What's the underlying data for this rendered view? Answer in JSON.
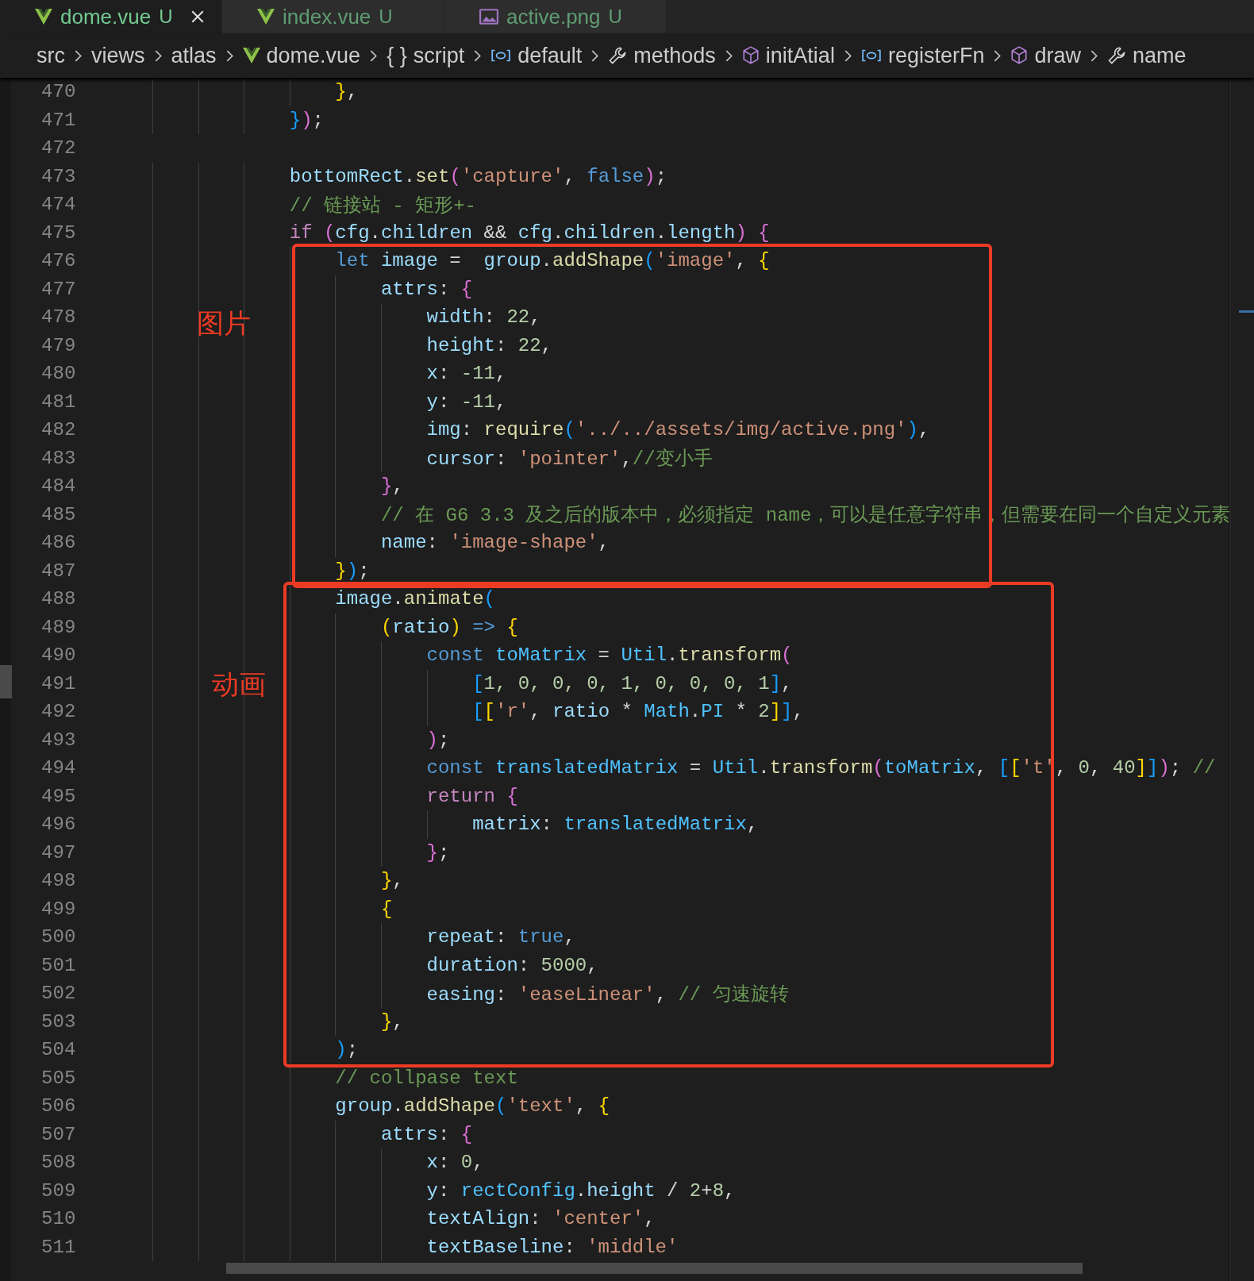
{
  "tabs": [
    {
      "label": "dome.vue",
      "status": "U",
      "kind": "vue",
      "selected": true
    },
    {
      "label": "index.vue",
      "status": "U",
      "kind": "vue",
      "selected": false
    },
    {
      "label": "active.png",
      "status": "U",
      "kind": "image",
      "selected": false
    }
  ],
  "breadcrumb": [
    {
      "label": "src",
      "kind": "folder"
    },
    {
      "label": "views",
      "kind": "folder"
    },
    {
      "label": "atlas",
      "kind": "folder"
    },
    {
      "label": "dome.vue",
      "kind": "vue"
    },
    {
      "label": "script",
      "kind": "glyph",
      "glyph": "{ }"
    },
    {
      "label": "default",
      "kind": "module"
    },
    {
      "label": "methods",
      "kind": "wrench"
    },
    {
      "label": "initAtial",
      "kind": "cube"
    },
    {
      "label": "registerFn",
      "kind": "module"
    },
    {
      "label": "draw",
      "kind": "cube"
    },
    {
      "label": "name",
      "kind": "wrench"
    }
  ],
  "lines": [
    {
      "number": "470",
      "tokens": [
        {
          "kind": "b1",
          "text": "                    }"
        },
        {
          "kind": "p",
          "text": ","
        }
      ]
    },
    {
      "number": "471",
      "tokens": [
        {
          "kind": "b3",
          "text": "                }"
        },
        {
          "kind": "b2",
          "text": ")"
        },
        {
          "kind": "p",
          "text": ";"
        }
      ]
    },
    {
      "number": "472"
    },
    {
      "number": "473",
      "tokens": [
        {
          "kind": "var",
          "text": "                bottomRect"
        },
        {
          "kind": "p",
          "text": "."
        },
        {
          "kind": "func",
          "text": "set"
        },
        {
          "kind": "b2",
          "text": "("
        },
        {
          "kind": "str",
          "text": "'capture'"
        },
        {
          "kind": "p",
          "text": ", "
        },
        {
          "kind": "kw",
          "text": "false"
        },
        {
          "kind": "b2",
          "text": ")"
        },
        {
          "kind": "p",
          "text": ";"
        }
      ]
    },
    {
      "number": "474",
      "tokens": [
        {
          "kind": "com",
          "text": "                // 链接站 - 矩形+-"
        }
      ]
    },
    {
      "number": "475",
      "tokens": [
        {
          "kind": "ctl",
          "text": "                if "
        },
        {
          "kind": "b2",
          "text": "("
        },
        {
          "kind": "var",
          "text": "cfg"
        },
        {
          "kind": "p",
          "text": "."
        },
        {
          "kind": "var",
          "text": "children"
        },
        {
          "kind": "p",
          "text": " && "
        },
        {
          "kind": "var",
          "text": "cfg"
        },
        {
          "kind": "p",
          "text": "."
        },
        {
          "kind": "var",
          "text": "children"
        },
        {
          "kind": "p",
          "text": "."
        },
        {
          "kind": "var",
          "text": "length"
        },
        {
          "kind": "b2",
          "text": ") {"
        }
      ]
    },
    {
      "number": "476",
      "tokens": [
        {
          "kind": "kw",
          "text": "                    let "
        },
        {
          "kind": "var",
          "text": "image"
        },
        {
          "kind": "p",
          "text": " =  "
        },
        {
          "kind": "var",
          "text": "group"
        },
        {
          "kind": "p",
          "text": "."
        },
        {
          "kind": "func",
          "text": "addShape"
        },
        {
          "kind": "b3",
          "text": "("
        },
        {
          "kind": "str",
          "text": "'image'"
        },
        {
          "kind": "p",
          "text": ", "
        },
        {
          "kind": "b1",
          "text": "{"
        }
      ]
    },
    {
      "number": "477",
      "tokens": [
        {
          "kind": "var",
          "text": "                        attrs"
        },
        {
          "kind": "p",
          "text": ": "
        },
        {
          "kind": "b2",
          "text": "{"
        }
      ]
    },
    {
      "number": "478",
      "tokens": [
        {
          "kind": "var",
          "text": "                            width"
        },
        {
          "kind": "p",
          "text": ": "
        },
        {
          "kind": "num",
          "text": "22"
        },
        {
          "kind": "p",
          "text": ","
        }
      ]
    },
    {
      "number": "479",
      "tokens": [
        {
          "kind": "var",
          "text": "                            height"
        },
        {
          "kind": "p",
          "text": ": "
        },
        {
          "kind": "num",
          "text": "22"
        },
        {
          "kind": "p",
          "text": ","
        }
      ]
    },
    {
      "number": "480",
      "tokens": [
        {
          "kind": "var",
          "text": "                            x"
        },
        {
          "kind": "p",
          "text": ": "
        },
        {
          "kind": "num",
          "text": "-11"
        },
        {
          "kind": "p",
          "text": ","
        }
      ]
    },
    {
      "number": "481",
      "tokens": [
        {
          "kind": "var",
          "text": "                            y"
        },
        {
          "kind": "p",
          "text": ": "
        },
        {
          "kind": "num",
          "text": "-11"
        },
        {
          "kind": "p",
          "text": ","
        }
      ]
    },
    {
      "number": "482",
      "tokens": [
        {
          "kind": "var",
          "text": "                            img"
        },
        {
          "kind": "p",
          "text": ": "
        },
        {
          "kind": "func",
          "text": "require"
        },
        {
          "kind": "b3",
          "text": "("
        },
        {
          "kind": "str",
          "text": "'../../assets/img/active.png'"
        },
        {
          "kind": "b3",
          "text": ")"
        },
        {
          "kind": "p",
          "text": ","
        }
      ]
    },
    {
      "number": "483",
      "tokens": [
        {
          "kind": "var",
          "text": "                            cursor"
        },
        {
          "kind": "p",
          "text": ": "
        },
        {
          "kind": "str",
          "text": "'pointer'"
        },
        {
          "kind": "p",
          "text": ","
        },
        {
          "kind": "com",
          "text": "//变小手"
        }
      ]
    },
    {
      "number": "484",
      "tokens": [
        {
          "kind": "b2",
          "text": "                        }"
        },
        {
          "kind": "p",
          "text": ","
        }
      ]
    },
    {
      "number": "485",
      "tokens": [
        {
          "kind": "com",
          "text": "                        // 在 G6 3.3 及之后的版本中，必须指定 name，可以是任意字符串，但需要在同一个自定义元素"
        }
      ]
    },
    {
      "number": "486",
      "tokens": [
        {
          "kind": "var",
          "text": "                        name"
        },
        {
          "kind": "p",
          "text": ": "
        },
        {
          "kind": "str",
          "text": "'image-shape'"
        },
        {
          "kind": "p",
          "text": ","
        }
      ]
    },
    {
      "number": "487",
      "tokens": [
        {
          "kind": "b1",
          "text": "                    }"
        },
        {
          "kind": "b3",
          "text": ")"
        },
        {
          "kind": "p",
          "text": ";"
        }
      ]
    },
    {
      "number": "488",
      "tokens": [
        {
          "kind": "var",
          "text": "                    image"
        },
        {
          "kind": "p",
          "text": "."
        },
        {
          "kind": "func",
          "text": "animate"
        },
        {
          "kind": "b3",
          "text": "("
        }
      ]
    },
    {
      "number": "489",
      "tokens": [
        {
          "kind": "b1",
          "text": "                        ("
        },
        {
          "kind": "var",
          "text": "ratio"
        },
        {
          "kind": "b1",
          "text": ") "
        },
        {
          "kind": "kw",
          "text": "=> "
        },
        {
          "kind": "b1",
          "text": "{"
        }
      ]
    },
    {
      "number": "490",
      "tokens": [
        {
          "kind": "kw",
          "text": "                            const "
        },
        {
          "kind": "const",
          "text": "toMatrix"
        },
        {
          "kind": "p",
          "text": " = "
        },
        {
          "kind": "const",
          "text": "Util"
        },
        {
          "kind": "p",
          "text": "."
        },
        {
          "kind": "func",
          "text": "transform"
        },
        {
          "kind": "b2",
          "text": "("
        }
      ]
    },
    {
      "number": "491",
      "tokens": [
        {
          "kind": "b3",
          "text": "                                ["
        },
        {
          "kind": "num",
          "text": "1, 0, 0, 0, 1, 0, 0, 0, 1"
        },
        {
          "kind": "b3",
          "text": "]"
        },
        {
          "kind": "p",
          "text": ","
        }
      ]
    },
    {
      "number": "492",
      "tokens": [
        {
          "kind": "b3",
          "text": "                                ["
        },
        {
          "kind": "b1",
          "text": "["
        },
        {
          "kind": "str",
          "text": "'r'"
        },
        {
          "kind": "p",
          "text": ", "
        },
        {
          "kind": "var",
          "text": "ratio"
        },
        {
          "kind": "p",
          "text": " * "
        },
        {
          "kind": "const",
          "text": "Math"
        },
        {
          "kind": "p",
          "text": "."
        },
        {
          "kind": "const",
          "text": "PI"
        },
        {
          "kind": "p",
          "text": " * "
        },
        {
          "kind": "num",
          "text": "2"
        },
        {
          "kind": "b1",
          "text": "]"
        },
        {
          "kind": "b3",
          "text": "]"
        },
        {
          "kind": "p",
          "text": ","
        }
      ]
    },
    {
      "number": "493",
      "tokens": [
        {
          "kind": "b2",
          "text": "                            )"
        },
        {
          "kind": "p",
          "text": ";"
        }
      ]
    },
    {
      "number": "494",
      "tokens": [
        {
          "kind": "kw",
          "text": "                            const "
        },
        {
          "kind": "const",
          "text": "translatedMatrix"
        },
        {
          "kind": "p",
          "text": " = "
        },
        {
          "kind": "const",
          "text": "Util"
        },
        {
          "kind": "p",
          "text": "."
        },
        {
          "kind": "func",
          "text": "transform"
        },
        {
          "kind": "b2",
          "text": "("
        },
        {
          "kind": "const",
          "text": "toMatrix"
        },
        {
          "kind": "p",
          "text": ", "
        },
        {
          "kind": "b3",
          "text": "["
        },
        {
          "kind": "b1",
          "text": "["
        },
        {
          "kind": "str",
          "text": "'t'"
        },
        {
          "kind": "p",
          "text": ", "
        },
        {
          "kind": "num",
          "text": "0"
        },
        {
          "kind": "p",
          "text": ", "
        },
        {
          "kind": "num",
          "text": "40"
        },
        {
          "kind": "b1",
          "text": "]"
        },
        {
          "kind": "b3",
          "text": "]"
        },
        {
          "kind": "b2",
          "text": ")"
        },
        {
          "kind": "p",
          "text": "; "
        },
        {
          "kind": "com",
          "text": "//"
        }
      ]
    },
    {
      "number": "495",
      "tokens": [
        {
          "kind": "ctl",
          "text": "                            return "
        },
        {
          "kind": "b2",
          "text": "{"
        }
      ]
    },
    {
      "number": "496",
      "tokens": [
        {
          "kind": "var",
          "text": "                                matrix"
        },
        {
          "kind": "p",
          "text": ": "
        },
        {
          "kind": "const",
          "text": "translatedMatrix"
        },
        {
          "kind": "p",
          "text": ","
        }
      ]
    },
    {
      "number": "497",
      "tokens": [
        {
          "kind": "b2",
          "text": "                            }"
        },
        {
          "kind": "p",
          "text": ";"
        }
      ]
    },
    {
      "number": "498",
      "tokens": [
        {
          "kind": "b1",
          "text": "                        }"
        },
        {
          "kind": "p",
          "text": ","
        }
      ]
    },
    {
      "number": "499",
      "tokens": [
        {
          "kind": "b1",
          "text": "                        {"
        }
      ]
    },
    {
      "number": "500",
      "tokens": [
        {
          "kind": "var",
          "text": "                            repeat"
        },
        {
          "kind": "p",
          "text": ": "
        },
        {
          "kind": "kw",
          "text": "true"
        },
        {
          "kind": "p",
          "text": ","
        }
      ]
    },
    {
      "number": "501",
      "tokens": [
        {
          "kind": "var",
          "text": "                            duration"
        },
        {
          "kind": "p",
          "text": ": "
        },
        {
          "kind": "num",
          "text": "5000"
        },
        {
          "kind": "p",
          "text": ","
        }
      ]
    },
    {
      "number": "502",
      "tokens": [
        {
          "kind": "var",
          "text": "                            easing"
        },
        {
          "kind": "p",
          "text": ": "
        },
        {
          "kind": "str",
          "text": "'easeLinear'"
        },
        {
          "kind": "p",
          "text": ", "
        },
        {
          "kind": "com",
          "text": "// 匀速旋转"
        }
      ]
    },
    {
      "number": "503",
      "tokens": [
        {
          "kind": "b1",
          "text": "                        }"
        },
        {
          "kind": "p",
          "text": ","
        }
      ]
    },
    {
      "number": "504",
      "tokens": [
        {
          "kind": "b3",
          "text": "                    )"
        },
        {
          "kind": "p",
          "text": ";"
        }
      ]
    },
    {
      "number": "505",
      "tokens": [
        {
          "kind": "com",
          "text": "                    // collpase text"
        }
      ]
    },
    {
      "number": "506",
      "tokens": [
        {
          "kind": "var",
          "text": "                    group"
        },
        {
          "kind": "p",
          "text": "."
        },
        {
          "kind": "func",
          "text": "addShape"
        },
        {
          "kind": "b3",
          "text": "("
        },
        {
          "kind": "str",
          "text": "'text'"
        },
        {
          "kind": "p",
          "text": ", "
        },
        {
          "kind": "b1",
          "text": "{"
        }
      ]
    },
    {
      "number": "507",
      "tokens": [
        {
          "kind": "var",
          "text": "                        attrs"
        },
        {
          "kind": "p",
          "text": ": "
        },
        {
          "kind": "b2",
          "text": "{"
        }
      ]
    },
    {
      "number": "508",
      "tokens": [
        {
          "kind": "var",
          "text": "                            x"
        },
        {
          "kind": "p",
          "text": ": "
        },
        {
          "kind": "num",
          "text": "0"
        },
        {
          "kind": "p",
          "text": ","
        }
      ]
    },
    {
      "number": "509",
      "tokens": [
        {
          "kind": "var",
          "text": "                            y"
        },
        {
          "kind": "p",
          "text": ": "
        },
        {
          "kind": "const",
          "text": "rectConfig"
        },
        {
          "kind": "p",
          "text": "."
        },
        {
          "kind": "var",
          "text": "height"
        },
        {
          "kind": "p",
          "text": " / "
        },
        {
          "kind": "num",
          "text": "2"
        },
        {
          "kind": "p",
          "text": "+"
        },
        {
          "kind": "num",
          "text": "8"
        },
        {
          "kind": "p",
          "text": ","
        }
      ]
    },
    {
      "number": "510",
      "tokens": [
        {
          "kind": "var",
          "text": "                            textAlign"
        },
        {
          "kind": "p",
          "text": ": "
        },
        {
          "kind": "str",
          "text": "'center'"
        },
        {
          "kind": "p",
          "text": ","
        }
      ]
    },
    {
      "number": "511",
      "tokens": [
        {
          "kind": "var",
          "text": "                            textBaseline"
        },
        {
          "kind": "p",
          "text": ": "
        },
        {
          "kind": "str",
          "text": "'middle'"
        }
      ]
    }
  ],
  "annotations": [
    {
      "label": "图片"
    },
    {
      "label": "动画"
    }
  ]
}
